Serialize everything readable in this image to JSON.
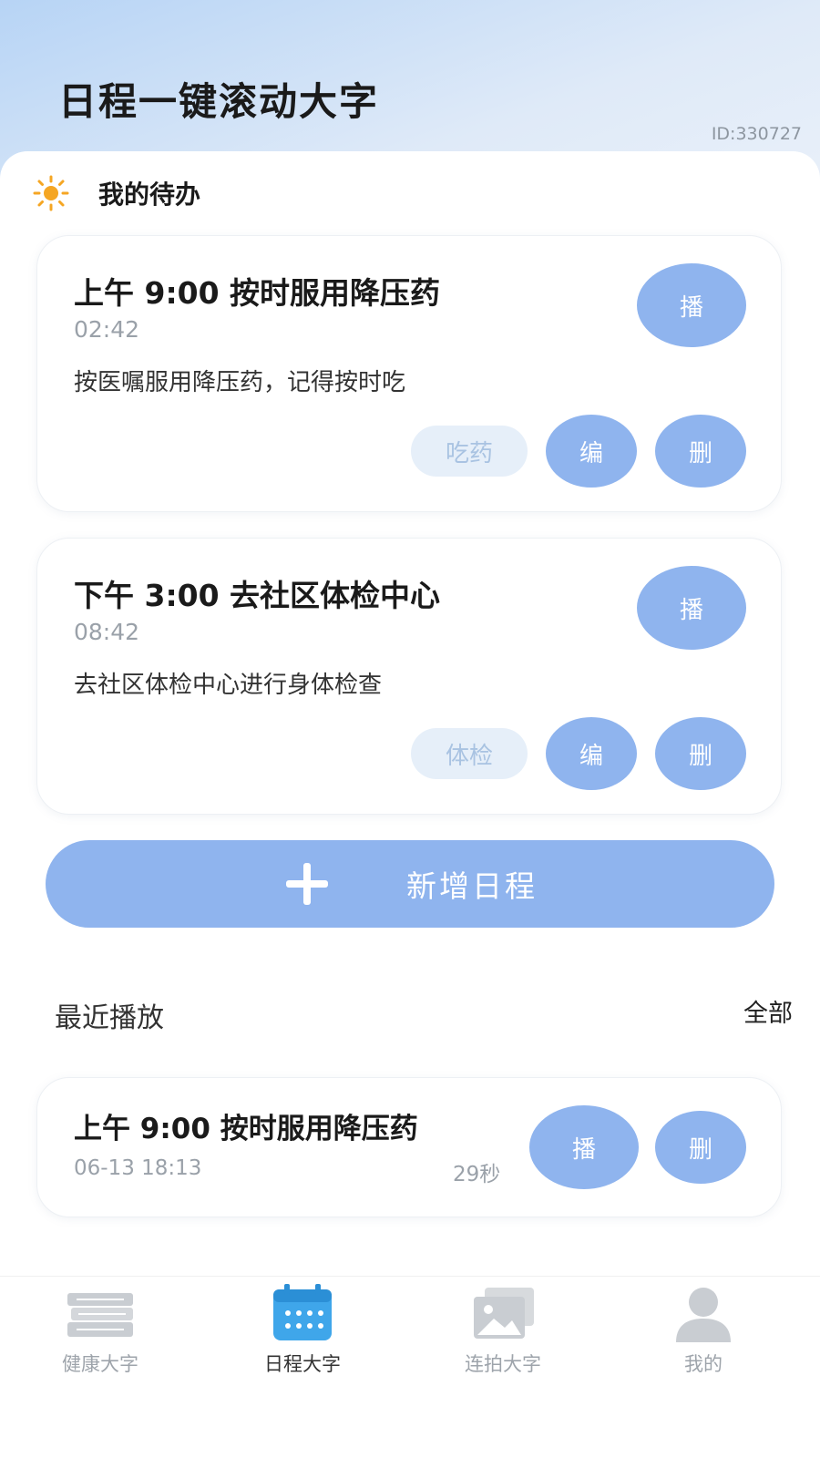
{
  "header": {
    "title": "日程一键滚动大字",
    "id_text": "ID:330727"
  },
  "todo": {
    "section_title": "我的待办",
    "items": [
      {
        "title": "上午 9:00 按时服用降压药",
        "time": "02:42",
        "desc": "按医嘱服用降压药，记得按时吃",
        "tag": "吃药",
        "play_label": "播",
        "edit_label": "编",
        "delete_label": "删"
      },
      {
        "title": "下午 3:00 去社区体检中心",
        "time": "08:42",
        "desc": "去社区体检中心进行身体检查",
        "tag": "体检",
        "play_label": "播",
        "edit_label": "编",
        "delete_label": "删"
      }
    ],
    "add_label": "新增日程"
  },
  "recent": {
    "section_title": "最近播放",
    "all_label": "全部",
    "items": [
      {
        "title": "上午 9:00 按时服用降压药",
        "datetime": "06-13 18:13",
        "duration": "29秒",
        "play_label": "播",
        "delete_label": "删"
      }
    ]
  },
  "tabbar": {
    "active": "schedule",
    "tabs": [
      {
        "id": "health",
        "label": "健康大字",
        "icon": "book-stack-icon"
      },
      {
        "id": "schedule",
        "label": "日程大字",
        "icon": "calendar-icon"
      },
      {
        "id": "photo",
        "label": "连拍大字",
        "icon": "photo-stack-icon"
      },
      {
        "id": "me",
        "label": "我的",
        "icon": "user-icon"
      }
    ]
  },
  "colors": {
    "accent": "#8fb4ee",
    "tag_bg": "#e6eff9",
    "tag_text": "#a9c3e2",
    "active_tab_icon": "#3fa6ea",
    "inactive_tab_icon": "#c9cdd2"
  }
}
